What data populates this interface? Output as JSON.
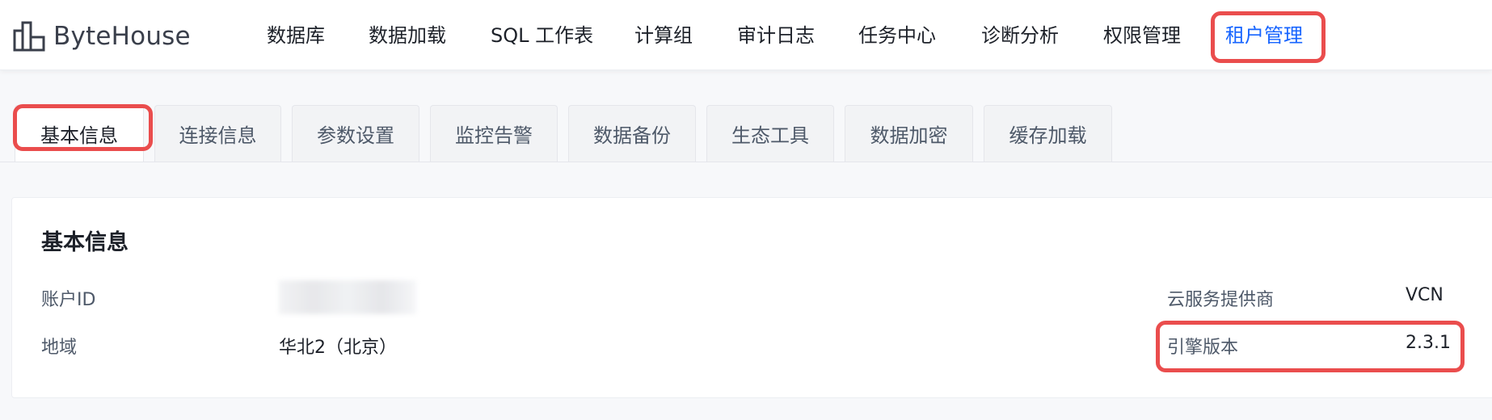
{
  "brand": {
    "name": "ByteHouse"
  },
  "nav": {
    "items": [
      {
        "label": "数据库"
      },
      {
        "label": "数据加载"
      },
      {
        "label": "SQL 工作表"
      },
      {
        "label": "计算组"
      },
      {
        "label": "审计日志"
      },
      {
        "label": "任务中心"
      },
      {
        "label": "诊断分析"
      },
      {
        "label": "权限管理"
      },
      {
        "label": "租户管理",
        "active": true
      }
    ]
  },
  "tabs": [
    {
      "label": "基本信息",
      "active": true
    },
    {
      "label": "连接信息"
    },
    {
      "label": "参数设置"
    },
    {
      "label": "监控告警"
    },
    {
      "label": "数据备份"
    },
    {
      "label": "生态工具"
    },
    {
      "label": "数据加密"
    },
    {
      "label": "缓存加载"
    }
  ],
  "info": {
    "title": "基本信息",
    "account_id_label": "账户ID",
    "region_label": "地域",
    "region_value": "华北2（北京）",
    "provider_label": "云服务提供商",
    "provider_value": "VCN",
    "engine_label": "引擎版本",
    "engine_value": "2.3.1"
  },
  "colors": {
    "accent": "#1664ff",
    "highlight": "#ea4d4d"
  }
}
